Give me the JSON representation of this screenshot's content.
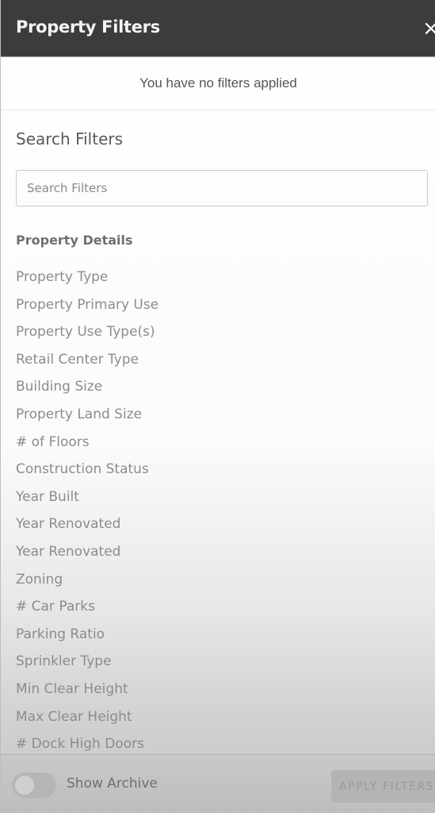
{
  "header": {
    "title": "Property Filters",
    "close_icon": "×"
  },
  "status": {
    "message": "You have no filters applied"
  },
  "search": {
    "title": "Search Filters",
    "placeholder": "Search Filters",
    "value": ""
  },
  "groups": [
    {
      "title": "Property Details",
      "items": [
        "Property Type",
        "Property Primary Use",
        "Property Use Type(s)",
        "Retail Center Type",
        "Building Size",
        "Property Land Size",
        "# of Floors",
        "Construction Status",
        "Year Built",
        "Year Renovated",
        "Year Renovated",
        "Zoning",
        "# Car Parks",
        "Parking Ratio",
        "Sprinkler Type",
        "Min Clear Height",
        "Max Clear Height",
        "# Dock High Doors"
      ]
    }
  ],
  "footer": {
    "toggle_label": "Show Archive",
    "toggle_on": false,
    "apply_label": "APPLY FILTERS",
    "apply_disabled": true
  }
}
